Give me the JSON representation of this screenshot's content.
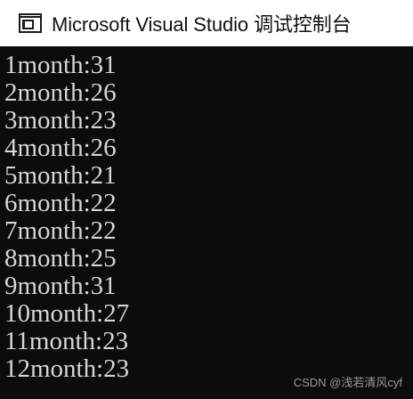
{
  "window": {
    "title": "Microsoft Visual Studio 调试控制台",
    "icon": "console-window-icon"
  },
  "console": {
    "lines": [
      "1month:31",
      "2month:26",
      "3month:23",
      "4month:26",
      "5month:21",
      "6month:22",
      "7month:22",
      "8month:25",
      "9month:31",
      "10month:27",
      "11month:23",
      "12month:23"
    ]
  },
  "watermark": "CSDN @浅若清风cyf",
  "colors": {
    "titlebar_bg": "#ffffff",
    "console_bg": "#0c0c0c",
    "console_text": "#d6d6d6"
  }
}
